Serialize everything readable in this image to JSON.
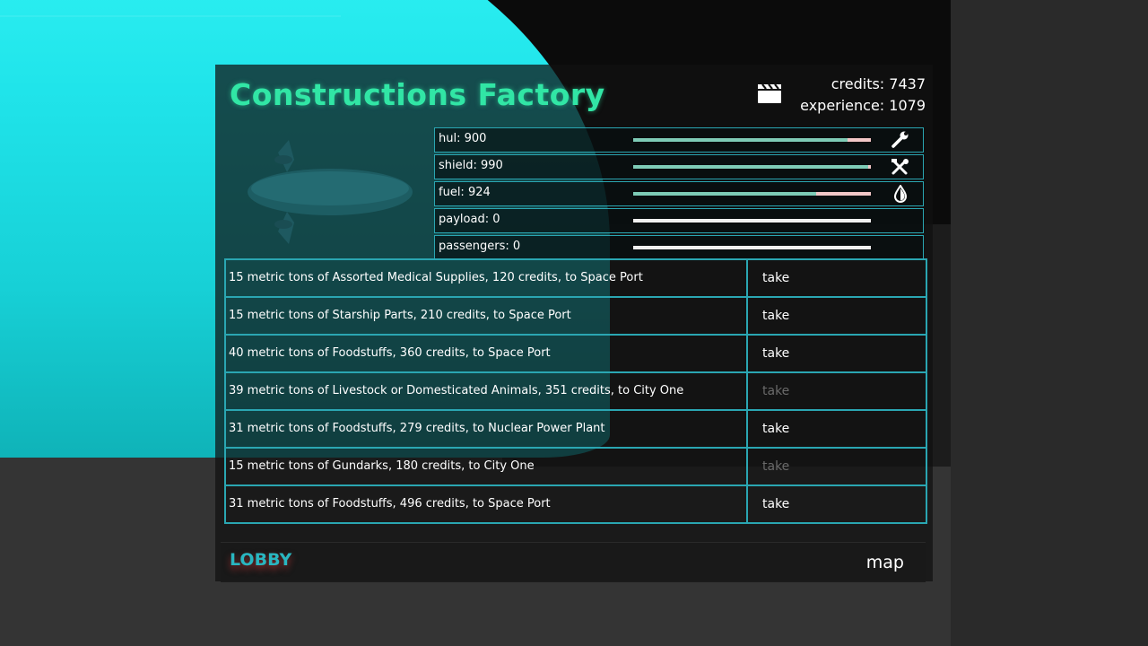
{
  "header": {
    "title": "Constructions Factory",
    "credits": "credits: 7437",
    "experience": "experience: 1079",
    "icon": "clapperboard-icon"
  },
  "gauges": [
    {
      "label": "hul: 900",
      "fill": 0.9,
      "icon": "wrench-icon"
    },
    {
      "label": "shield: 990",
      "fill": 0.99,
      "icon": "repair-tools-icon"
    },
    {
      "label": "fuel: 924",
      "fill": 0.77,
      "icon": "fuel-drop-icon"
    },
    {
      "label": "payload: 0",
      "fill": 0
    },
    {
      "label": "passengers: 0",
      "fill": 0
    }
  ],
  "jobs": [
    {
      "desc": "15 metric tons of Assorted Medical Supplies, 120 credits, to Space Port",
      "action": "take",
      "enabled": true
    },
    {
      "desc": "15 metric tons of Starship Parts, 210 credits, to Space Port",
      "action": "take",
      "enabled": true
    },
    {
      "desc": "40 metric tons of Foodstuffs, 360 credits, to Space Port",
      "action": "take",
      "enabled": true
    },
    {
      "desc": "39 metric tons of Livestock or Domesticated Animals, 351 credits, to City One",
      "action": "take",
      "enabled": false
    },
    {
      "desc": "31 metric tons of Foodstuffs, 279 credits, to Nuclear Power Plant",
      "action": "take",
      "enabled": true
    },
    {
      "desc": "15 metric tons of Gundarks, 180 credits, to City One",
      "action": "take",
      "enabled": false
    },
    {
      "desc": "31 metric tons of Foodstuffs, 496 credits, to Space Port",
      "action": "take",
      "enabled": true
    }
  ],
  "footer": {
    "lobby_label": "LOBBY",
    "map_label": "map"
  },
  "colors": {
    "accent_green": "#31e6a5",
    "border_teal": "#2aa6b2",
    "dome_cyan": "#20e4ea"
  }
}
